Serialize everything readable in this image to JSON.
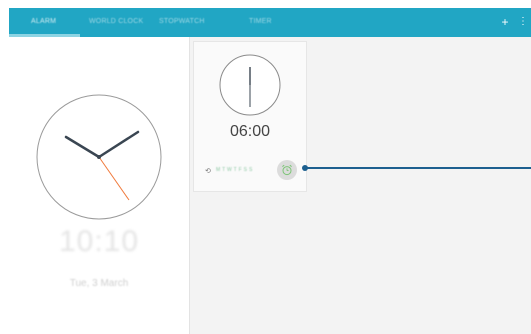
{
  "tabs": [
    {
      "label": "ALARM"
    },
    {
      "label": "WORLD CLOCK"
    },
    {
      "label": "STOPWATCH"
    },
    {
      "label": "TIMER"
    }
  ],
  "actions": {
    "add_icon": "plus-icon",
    "add_symbol": "+",
    "more_icon": "more-vertical-icon",
    "more_symbol": "⋮"
  },
  "clock": {
    "time": "10:10",
    "date": "Tue, 3 March"
  },
  "alarm": {
    "time": "06:00",
    "repeat_symbol": "⟲",
    "days": "M T W T F S S",
    "status_icon": "alarm-clock-icon"
  },
  "colors": {
    "top_bar": "#21a6c4",
    "second_hand": "#f07a3c",
    "alarm_icon": "#7cc576",
    "pointer": "#1c5f8f"
  }
}
